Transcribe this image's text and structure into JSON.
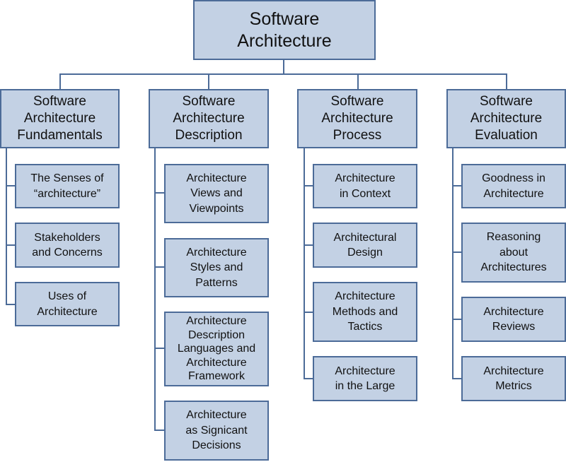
{
  "root": {
    "label": "Software\nArchitecture"
  },
  "categories": [
    {
      "label": "Software\nArchitecture\nFundamentals",
      "children": [
        "The Senses of\n“architecture”",
        "Stakeholders\nand Concerns",
        "Uses of\nArchitecture"
      ]
    },
    {
      "label": "Software\nArchitecture\nDescription",
      "children": [
        "Architecture\nViews and\nViewpoints",
        "Architecture\nStyles and\nPatterns",
        "Architecture\nDescription\nLanguages and\nArchitecture\nFramework",
        "Architecture\nas Signicant\nDecisions"
      ]
    },
    {
      "label": "Software\nArchitecture\nProcess",
      "children": [
        "Architecture\nin Context",
        "Architectural\nDesign",
        "Architecture\nMethods and\nTactics",
        "Architecture\nin the Large"
      ]
    },
    {
      "label": "Software\nArchitecture\nEvaluation",
      "children": [
        "Goodness in\nArchitecture",
        "Reasoning\nabout\nArchitectures",
        "Architecture\nReviews",
        "Architecture\nMetrics"
      ]
    }
  ],
  "colors": {
    "fill": "#c3d1e4",
    "border": "#4c6b98"
  }
}
